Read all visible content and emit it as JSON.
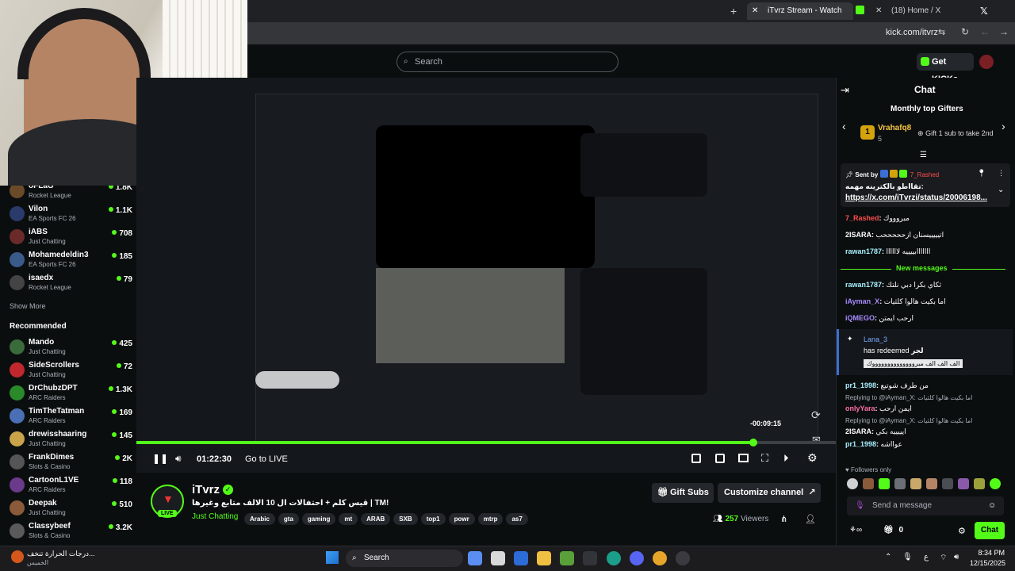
{
  "browser": {
    "tabs": [
      {
        "label": "iTvrz Stream - Watch Live o"
      },
      {
        "label": "(18) Home / X"
      }
    ],
    "url": "kick.com/itvrz"
  },
  "header": {
    "search_placeholder": "Search",
    "get_kicks": "Get KICKs"
  },
  "sidebar": {
    "following": [
      {
        "name": "oFLaG",
        "category": "Rocket League",
        "viewers": "1.8K",
        "color": "#6b4a2a"
      },
      {
        "name": "Vilon",
        "category": "EA Sports FC 26",
        "viewers": "1.1K",
        "color": "#2a3a6b"
      },
      {
        "name": "iABS",
        "category": "Just Chatting",
        "viewers": "708",
        "color": "#6b2a2a"
      },
      {
        "name": "Mohamedeldin3",
        "category": "EA Sports FC 26",
        "viewers": "185",
        "color": "#3a5a8a"
      },
      {
        "name": "isaedx",
        "category": "Rocket League",
        "viewers": "79",
        "color": "#444"
      }
    ],
    "show_more": "Show More",
    "recommended_title": "Recommended",
    "recommended": [
      {
        "name": "Mando",
        "category": "Just Chatting",
        "viewers": "425",
        "color": "#3a6b3a"
      },
      {
        "name": "SideScrollers",
        "category": "Just Chatting",
        "viewers": "72",
        "color": "#c0282d"
      },
      {
        "name": "DrChubzDPT",
        "category": "ARC Raiders",
        "viewers": "1.3K",
        "color": "#2a8a2a"
      },
      {
        "name": "TimTheTatman",
        "category": "ARC Raiders",
        "viewers": "169",
        "color": "#4a6fb5"
      },
      {
        "name": "drewisshaaring",
        "category": "Just Chatting",
        "viewers": "145",
        "color": "#c9a34a"
      },
      {
        "name": "FrankDimes",
        "category": "Slots & Casino",
        "viewers": "2K",
        "color": "#555"
      },
      {
        "name": "CartoonL1VE",
        "category": "ARC Raiders",
        "viewers": "118",
        "color": "#6b3a8a"
      },
      {
        "name": "Deepak",
        "category": "Just Chatting",
        "viewers": "510",
        "color": "#8a5a3a"
      },
      {
        "name": "Classybeef",
        "category": "Slots & Casino",
        "viewers": "3.2K",
        "color": "#5a5a5a"
      }
    ]
  },
  "player": {
    "time": "01:22:30",
    "go_live": "Go to LIVE",
    "behind": "-00:09:15",
    "progress": 0.882
  },
  "stream": {
    "channel": "iTvrz",
    "title": "قيس كلم + احتفالات ال 10 الالف متابع وغيرها | TM!",
    "category": "Just Chatting",
    "live_label": "LIVE",
    "tags": [
      "Arabic",
      "gta",
      "gaming",
      "mt",
      "ARAB",
      "SXB",
      "top1",
      "powr",
      "mtrp",
      "as7"
    ],
    "viewers": "257",
    "viewers_label": "Viewers",
    "gift_subs": "Gift Subs",
    "customize": "Customize channel"
  },
  "chat": {
    "title": "Chat",
    "gifters_title": "Monthly top Gifters",
    "top_gifter": "Vrahafq8",
    "top_gifter_count": "5",
    "gift_prompt": "Gift 1 sub to take 2nd",
    "pinned_sent_by": "Sent by",
    "pinned_user": "7_Rashed",
    "pinned_text": "تقااطو بالكترينه مهمه:",
    "pinned_link": "https://x.com/iTvrzi/status/20006198...",
    "new_messages": "New messages",
    "messages_before": [
      {
        "user": "7_Rashed",
        "color": "#ff4d4d",
        "text": "مبروووك"
      },
      {
        "user": "2ISARA",
        "color": "#ffffff",
        "text": "اتيييييسنان ازحححححب"
      },
      {
        "user": "rawan1787",
        "color": "#a8f0ff",
        "text": "ااااااابييييه لاااااا"
      }
    ],
    "messages_after": [
      {
        "user": "rawan1787",
        "color": "#a8f0ff",
        "text": "ثكاي بكرا دبي نلتك"
      },
      {
        "user": "iAyman_X",
        "color": "#a98bff",
        "text": "اما بكيت هالوا كلثيات"
      },
      {
        "user": "iQMEGO",
        "color": "#a98bff",
        "text": "ارحب ايمتن"
      }
    ],
    "redeem_user": "Lana_3",
    "redeem_text": "has redeemed",
    "redeem_reward": "لجر",
    "redeem_msg": "الف الف الف مبرووووووووووووووك",
    "messages_more": [
      {
        "user": "pr1_1998",
        "color": "#a8f0ff",
        "text": "من طرف شوتيع"
      },
      {
        "user": "onlyYara",
        "color": "#ff6fa8",
        "text": "ايمن ارحب",
        "reply": "Replying to @iAyman_X: اما بكيت هالوا كلثيات"
      },
      {
        "user": "2ISARA",
        "color": "#ffffff",
        "text": "ايييييه بكي",
        "reply": "Replying to @iAyman_X: اما بكيت هالوا كلثيات"
      },
      {
        "user": "pr1_1998",
        "color": "#a8f0ff",
        "text": "عوااشه"
      }
    ],
    "followers_only": "Followers only",
    "send_placeholder": "Send a message",
    "points": "0",
    "chat_button": "Chat"
  },
  "taskbar": {
    "weather_text": "درجات الحرارة تنخف...",
    "weather_sub": "الخميس",
    "search": "Search",
    "time": "8:34 PM",
    "date": "12/15/2025",
    "lang": "ع"
  },
  "colors": {
    "kick_green": "#53fc18",
    "bg": "#0b0e0f"
  }
}
